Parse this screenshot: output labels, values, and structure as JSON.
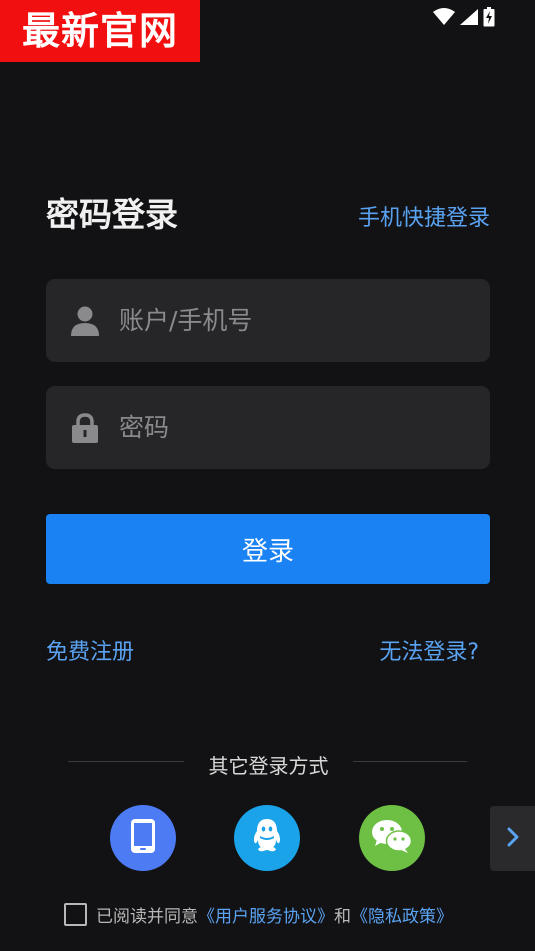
{
  "watermark": "最新官网",
  "status_bar": {
    "icons": [
      "wifi-icon",
      "signal-icon",
      "battery-charging-icon"
    ]
  },
  "header": {
    "title": "密码登录",
    "switch_link": "手机快捷登录"
  },
  "form": {
    "account_placeholder": "账户/手机号",
    "account_icon": "user-icon",
    "password_placeholder": "密码",
    "password_icon": "lock-icon",
    "login_label": "登录"
  },
  "links": {
    "register": "免费注册",
    "cannot_login": "无法登录?"
  },
  "other_login": {
    "divider_text": "其它登录方式",
    "methods": [
      {
        "icon": "phone-icon",
        "color": "#4d7bf3"
      },
      {
        "icon": "qq-icon",
        "color": "#1aa3e9"
      },
      {
        "icon": "wechat-icon",
        "color": "#6dc044"
      }
    ],
    "more_icon": "chevron-right-icon"
  },
  "agreement": {
    "prefix": "已阅读并同意",
    "terms": "《用户服务协议》",
    "and": "和",
    "privacy": "《隐私政策》",
    "checked": false
  },
  "colors": {
    "background": "#121214",
    "accent": "#1a82f2",
    "link": "#5aa2f2",
    "field": "#262628",
    "watermark_bg": "#f20f0f"
  }
}
